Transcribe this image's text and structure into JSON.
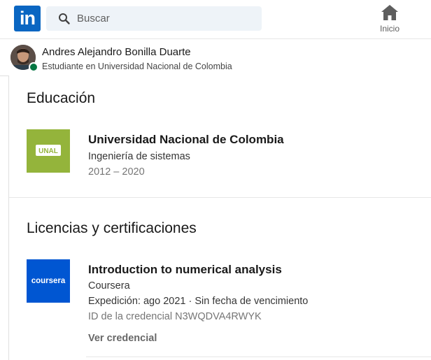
{
  "brand": {
    "logo_text": "in",
    "color": "#0a66c2"
  },
  "search": {
    "placeholder": "Buscar"
  },
  "nav": {
    "home_label": "Inicio"
  },
  "profile": {
    "name": "Andres Alejandro Bonilla Duarte",
    "headline": "Estudiante en Universidad Nacional de Colombia",
    "status_color": "#057642"
  },
  "education": {
    "heading": "Educación",
    "items": [
      {
        "logo_text": "UNAL",
        "logo_color": "#94b43b",
        "school": "Universidad Nacional de Colombia",
        "degree": "Ingeniería de sistemas",
        "years": "2012 – 2020"
      }
    ]
  },
  "certifications": {
    "heading": "Licencias y certificaciones",
    "items": [
      {
        "logo_text": "coursera",
        "logo_color": "#0056d2",
        "name": "Introduction to numerical analysis",
        "issuer": "Coursera",
        "issued": "Expedición: ago 2021 · Sin fecha de vencimiento",
        "credential_id": "ID de la credencial N3WQDVA4RWYK",
        "link_label": "Ver credencial"
      }
    ]
  }
}
